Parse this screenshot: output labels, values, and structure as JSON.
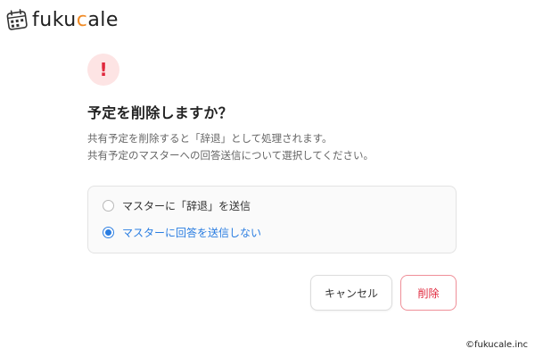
{
  "header": {
    "logo_text_prefix": "fuku",
    "logo_text_accent": "c",
    "logo_text_suffix": "ale",
    "logo_icon": "calendar-icon"
  },
  "dialog": {
    "icon": "exclamation-icon",
    "icon_glyph": "!",
    "title": "予定を削除しますか？",
    "description_line1": "共有予定を削除すると「辞退」として処理されます。",
    "description_line2": "共有予定のマスターへの回答送信について選択してください。",
    "options": [
      {
        "label": "マスターに「辞退」を送信",
        "selected": false
      },
      {
        "label": "マスターに回答を送信しない",
        "selected": true
      }
    ],
    "cancel_label": "キャンセル",
    "delete_label": "削除"
  },
  "footer": {
    "copyright": "©fukucale.inc"
  },
  "colors": {
    "accent_blue": "#2a7de1",
    "danger_red": "#e0283d",
    "logo_orange": "#f08a24"
  }
}
